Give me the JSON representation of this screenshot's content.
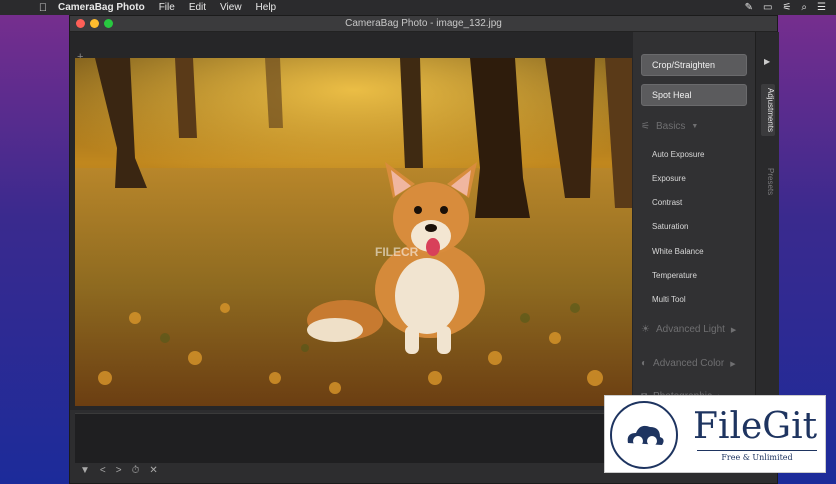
{
  "menubar": {
    "apple_icon": "",
    "app_name": "CameraBag Photo",
    "menus": [
      "File",
      "Edit",
      "View",
      "Help"
    ],
    "right_icons": [
      "brush-icon",
      "display-icon",
      "sliders-icon",
      "search-icon",
      "list-icon"
    ]
  },
  "window": {
    "title": "CameraBag Photo - image_132.jpg",
    "add_label": "+"
  },
  "photo": {
    "watermark_text": "FILECR"
  },
  "tools": {
    "crop_label": "Crop/Straighten",
    "spot_heal_label": "Spot Heal"
  },
  "sections": {
    "basics": "Basics",
    "advanced_light": "Advanced Light",
    "advanced_color": "Advanced Color",
    "photographic": "Photographic"
  },
  "adjustments": [
    "Auto Exposure",
    "Exposure",
    "Contrast",
    "Saturation",
    "White Balance",
    "Temperature",
    "Multi Tool"
  ],
  "tabs": {
    "adjustments": "Adjustments",
    "presets": "Presets"
  },
  "bottom_controls": [
    "▼",
    "<",
    ">",
    "⏱",
    "✕"
  ],
  "badge": {
    "title": "FileGit",
    "subtitle": "Free & Unlimited"
  },
  "colors": {
    "window_bg": "#2d2d2f",
    "button_bg": "#5b5b5d",
    "brand_blue": "#1e3460"
  }
}
